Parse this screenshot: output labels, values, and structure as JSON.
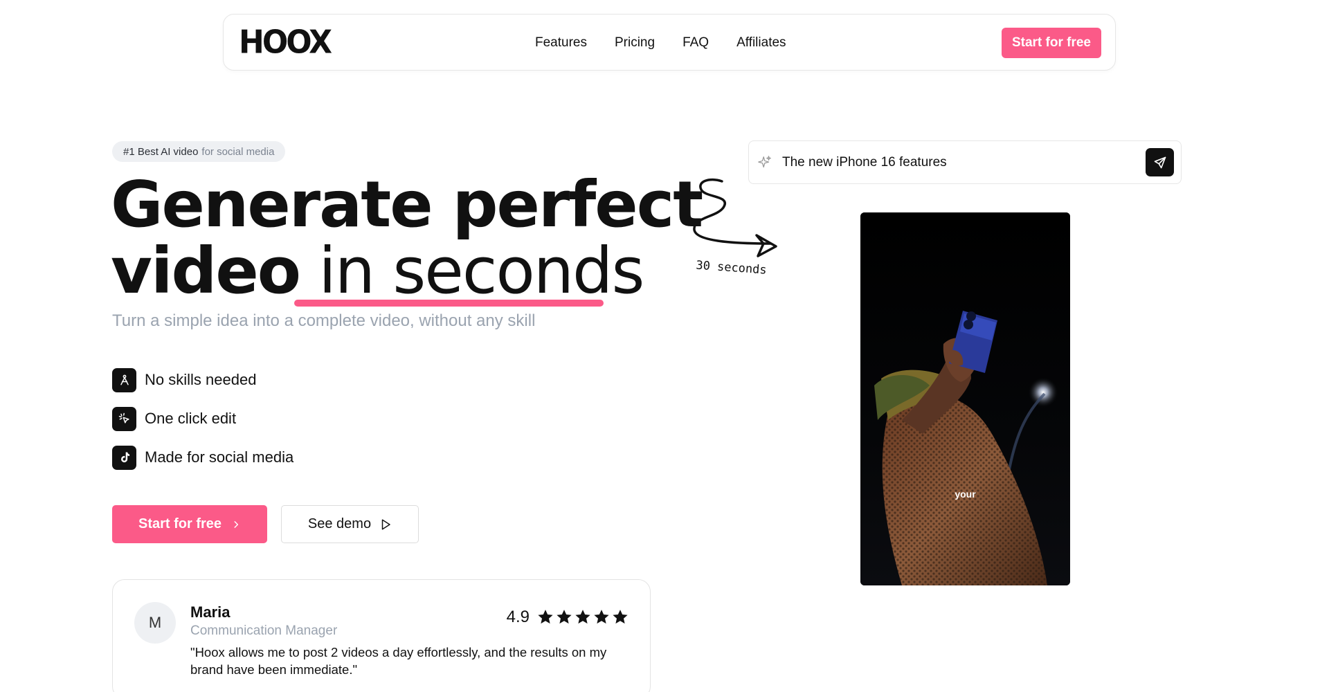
{
  "nav": {
    "logo": "HOOX",
    "links": [
      "Features",
      "Pricing",
      "FAQ",
      "Affiliates"
    ],
    "cta": "Start for free"
  },
  "hero": {
    "badge_strong": "#1 Best AI video",
    "badge_light": "for social media",
    "headline_line1": "Generate perfect",
    "headline_bold": "video",
    "headline_thin": "in seconds",
    "subtitle": "Turn a simple idea into a complete video, without any skill",
    "features": [
      {
        "label": "No skills needed",
        "icon": "pen-nib-icon"
      },
      {
        "label": "One click edit",
        "icon": "cursor-click-icon"
      },
      {
        "label": "Made for social media",
        "icon": "tiktok-icon"
      }
    ],
    "primary_cta": "Start for free",
    "secondary_cta": "See demo"
  },
  "review": {
    "avatar_initial": "M",
    "name": "Maria",
    "role": "Communication Manager",
    "quote": "\"Hoox allows me to post 2 videos a day effortlessly, and the results on my brand have been immediate.\"",
    "score": "4.9",
    "stars": 5
  },
  "prompt": {
    "text": "The new iPhone 16 features",
    "icon": "sparkle-icon",
    "send_icon": "send-icon"
  },
  "doodle": {
    "label": "30 seconds"
  },
  "video": {
    "caption": "your"
  },
  "colors": {
    "accent": "#fb5a88",
    "dark": "#111111",
    "muted": "#9aa3af"
  }
}
